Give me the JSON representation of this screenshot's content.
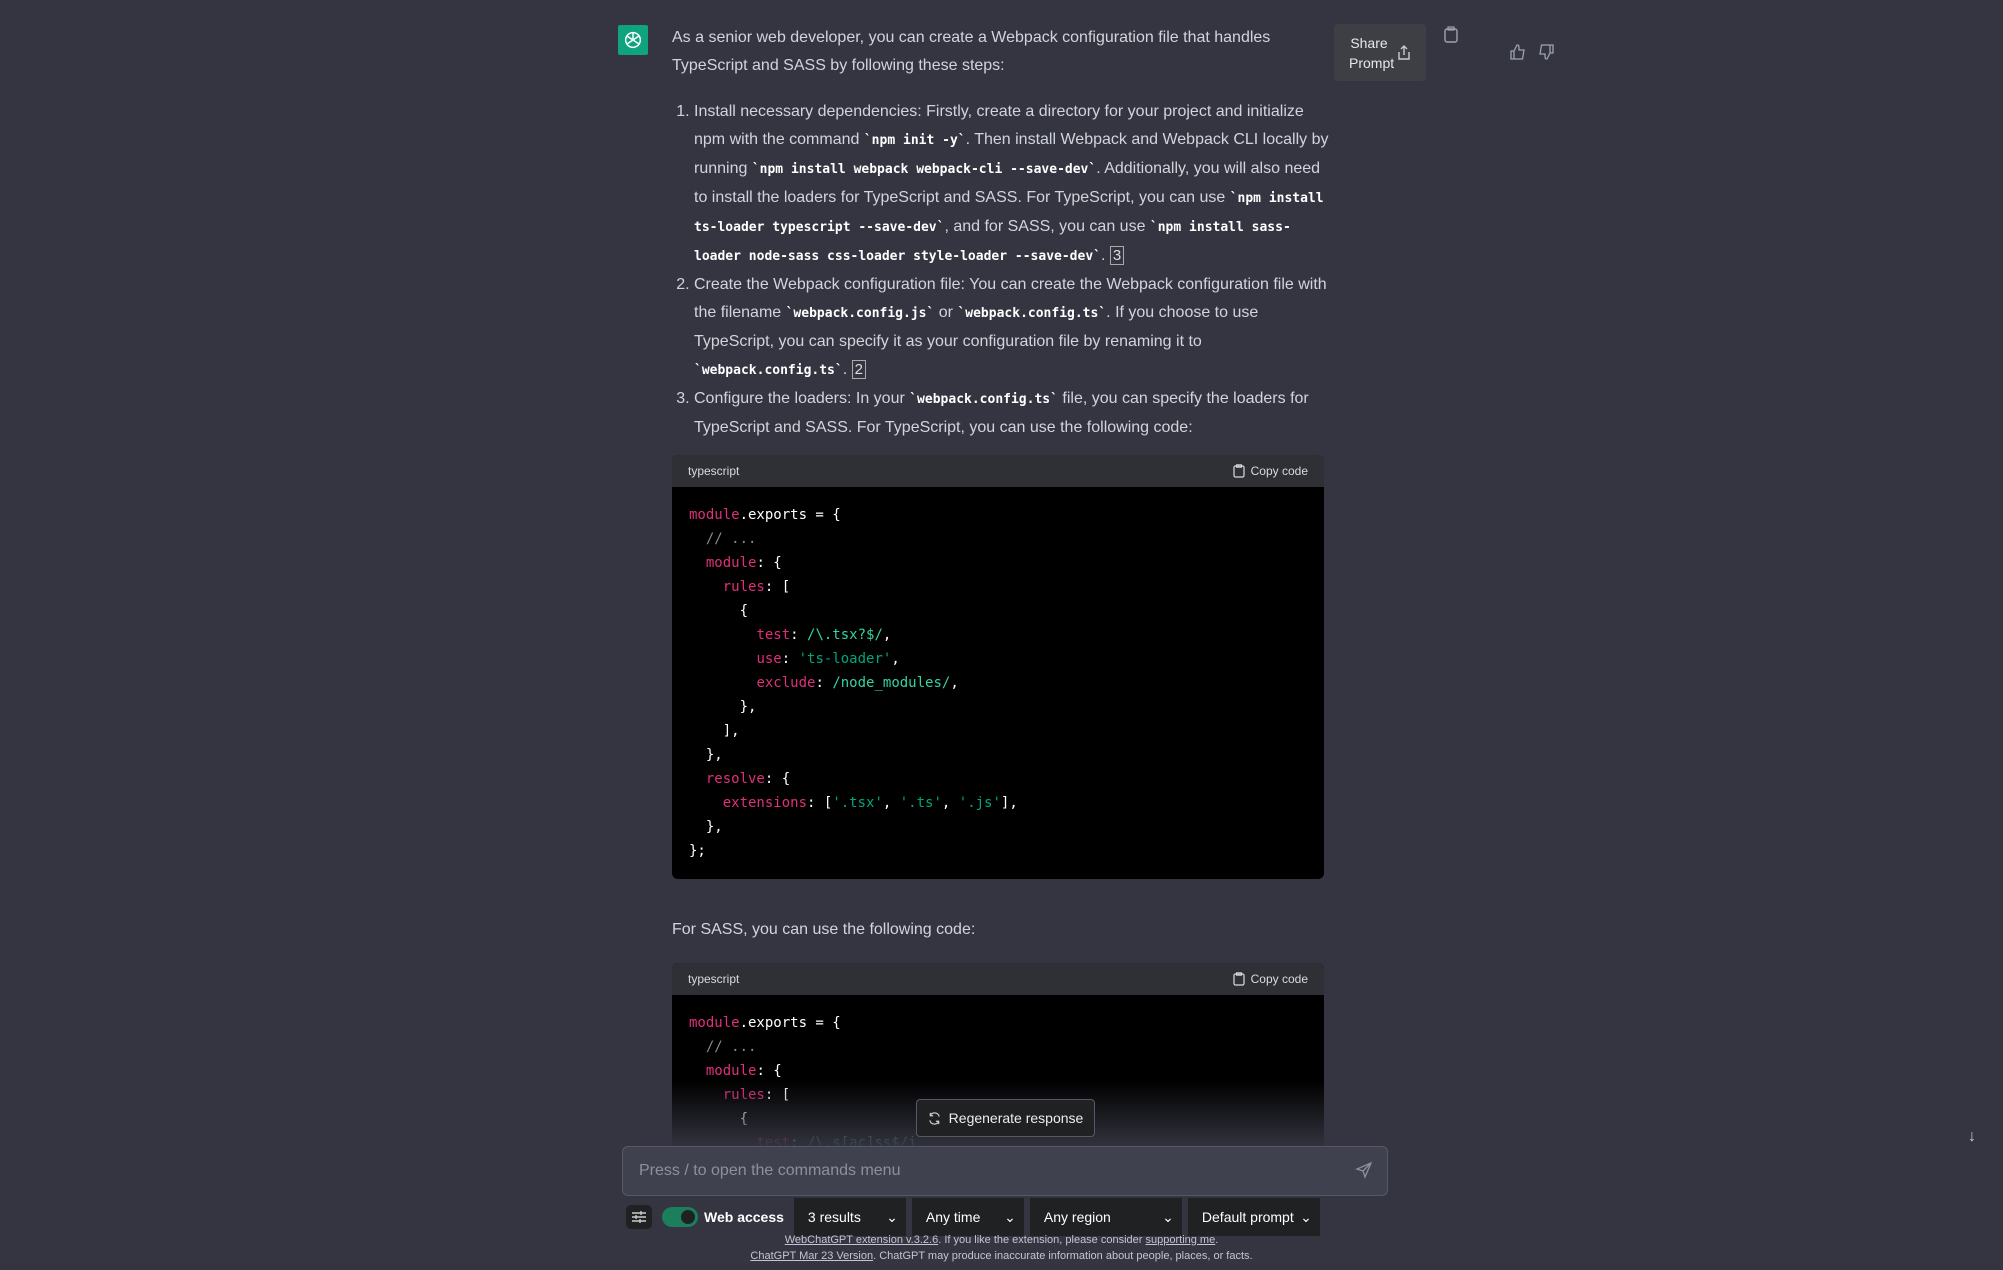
{
  "message": {
    "intro": "As a senior web developer, you can create a Webpack configuration file that handles TypeScript and SASS by following these steps:",
    "steps": [
      {
        "parts": [
          {
            "t": "Install necessary dependencies: Firstly, create a directory for your project and initialize npm with the command "
          },
          {
            "c": "`npm init -y`"
          },
          {
            "t": ". Then install Webpack and Webpack CLI locally by running "
          },
          {
            "c": "`npm install webpack webpack-cli --save-dev`"
          },
          {
            "t": ". Additionally, you will also need to install the loaders for TypeScript and SASS. For TypeScript, you can use "
          },
          {
            "c": "`npm install ts-loader typescript --save-dev`"
          },
          {
            "t": ", and for SASS, you can use "
          },
          {
            "c": "`npm install sass-loader node-sass css-loader style-loader --save-dev`"
          },
          {
            "t": ". "
          },
          {
            "cite": "3"
          }
        ]
      },
      {
        "parts": [
          {
            "t": "Create the Webpack configuration file: You can create the Webpack configuration file with the filename "
          },
          {
            "c": "`webpack.config.js`"
          },
          {
            "t": " or "
          },
          {
            "c": "`webpack.config.ts`"
          },
          {
            "t": ". If you choose to use TypeScript, you can specify it as your configuration file by renaming it to "
          },
          {
            "c": "`webpack.config.ts`"
          },
          {
            "t": ". "
          },
          {
            "cite": "2"
          }
        ]
      },
      {
        "parts": [
          {
            "t": "Configure the loaders: In your "
          },
          {
            "c": "`webpack.config.ts`"
          },
          {
            "t": " file, you can specify the loaders for TypeScript and SASS. For TypeScript, you can use the following code:"
          }
        ]
      }
    ],
    "sass_intro": "For SASS, you can use the following code:"
  },
  "share_prompt_label": "Share Prompt",
  "code_blocks": [
    {
      "language": "typescript",
      "copy_label": "Copy code",
      "lines": [
        [
          [
            "k",
            "module"
          ],
          [
            "p",
            ".exports = {"
          ]
        ],
        [
          [
            "p",
            "  "
          ],
          [
            "c",
            "// ..."
          ]
        ],
        [
          [
            "p",
            "  "
          ],
          [
            "k",
            "module"
          ],
          [
            "p",
            ": {"
          ]
        ],
        [
          [
            "p",
            "    "
          ],
          [
            "k",
            "rules"
          ],
          [
            "p",
            ": ["
          ]
        ],
        [
          [
            "p",
            "      {"
          ]
        ],
        [
          [
            "p",
            "        "
          ],
          [
            "k",
            "test"
          ],
          [
            "p",
            ": "
          ],
          [
            "r",
            "/\\.tsx?$/"
          ],
          [
            "p",
            ","
          ]
        ],
        [
          [
            "p",
            "        "
          ],
          [
            "k",
            "use"
          ],
          [
            "p",
            ": "
          ],
          [
            "s",
            "'ts-loader'"
          ],
          [
            "p",
            ","
          ]
        ],
        [
          [
            "p",
            "        "
          ],
          [
            "k",
            "exclude"
          ],
          [
            "p",
            ": "
          ],
          [
            "r",
            "/node_modules/"
          ],
          [
            "p",
            ","
          ]
        ],
        [
          [
            "p",
            "      },"
          ]
        ],
        [
          [
            "p",
            "    ],"
          ]
        ],
        [
          [
            "p",
            "  },"
          ]
        ],
        [
          [
            "p",
            "  "
          ],
          [
            "k",
            "resolve"
          ],
          [
            "p",
            ": {"
          ]
        ],
        [
          [
            "p",
            "    "
          ],
          [
            "k",
            "extensions"
          ],
          [
            "p",
            ": ["
          ],
          [
            "s",
            "'.tsx'"
          ],
          [
            "p",
            ", "
          ],
          [
            "s",
            "'.ts'"
          ],
          [
            "p",
            ", "
          ],
          [
            "s",
            "'.js'"
          ],
          [
            "p",
            "],"
          ]
        ],
        [
          [
            "p",
            "  },"
          ]
        ],
        [
          [
            "p",
            "};"
          ]
        ]
      ]
    },
    {
      "language": "typescript",
      "copy_label": "Copy code",
      "lines": [
        [
          [
            "k",
            "module"
          ],
          [
            "p",
            ".exports = {"
          ]
        ],
        [
          [
            "p",
            "  "
          ],
          [
            "c",
            "// ..."
          ]
        ],
        [
          [
            "p",
            "  "
          ],
          [
            "k",
            "module"
          ],
          [
            "p",
            ": {"
          ]
        ],
        [
          [
            "p",
            "    "
          ],
          [
            "k",
            "rules"
          ],
          [
            "p",
            ": ["
          ]
        ],
        [
          [
            "p",
            "      {"
          ]
        ],
        [
          [
            "p",
            "        "
          ],
          [
            "k",
            "test"
          ],
          [
            "p",
            ": "
          ],
          [
            "r",
            "/\\.s[ac]ss$/i"
          ]
        ]
      ]
    }
  ],
  "regenerate_label": "Regenerate response",
  "input": {
    "placeholder": "Press / to open the commands menu",
    "value": ""
  },
  "toolbar": {
    "web_access_label": "Web access",
    "web_access_on": true,
    "results": "3 results",
    "time": "Any time",
    "region": "Any region",
    "prompt": "Default prompt"
  },
  "footer": {
    "ext_link": "WebChatGPT extension v.3.2.6",
    "ext_text": ". If you like the extension, please consider ",
    "support_link": "supporting me",
    "ext_end": ".",
    "version_link": "ChatGPT Mar 23 Version",
    "version_text": ". ChatGPT may produce inaccurate information about people, places, or facts."
  },
  "colors": {
    "background": "#343541",
    "brand": "#10a37f",
    "keyword": "#df3079",
    "string": "#00a67d"
  }
}
